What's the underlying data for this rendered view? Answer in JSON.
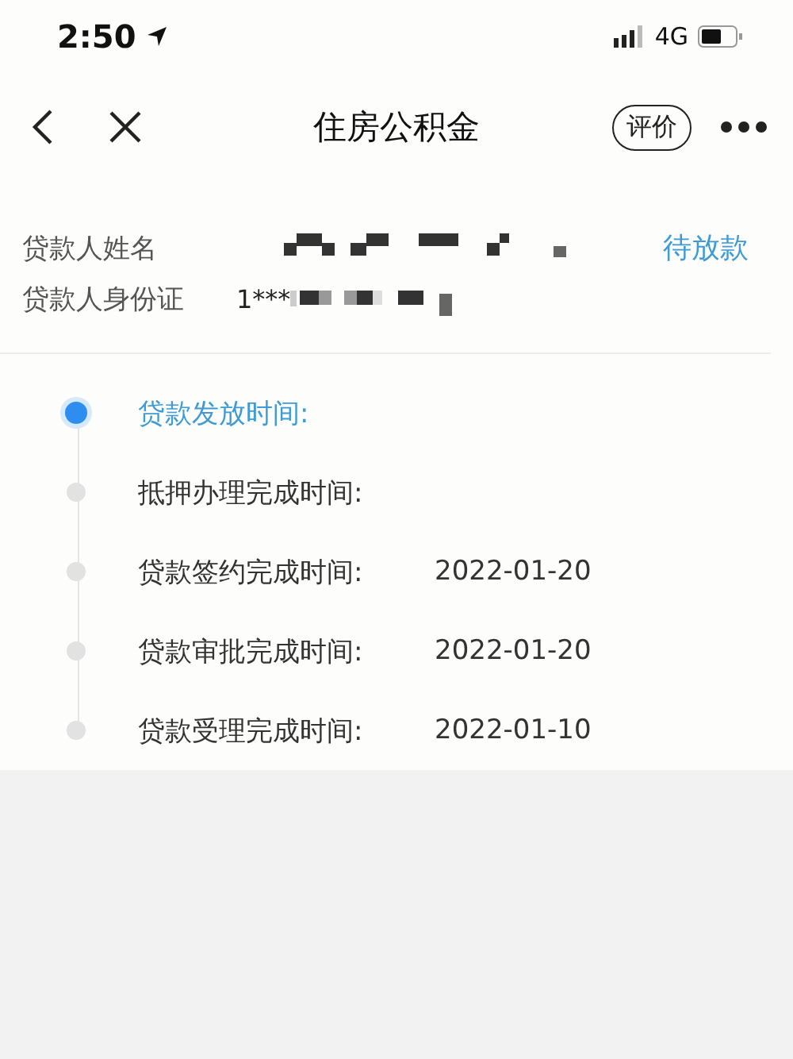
{
  "status_bar": {
    "time": "2:50",
    "network": "4G"
  },
  "nav": {
    "title": "住房公积金",
    "rate_button": "评价"
  },
  "info": {
    "rows": [
      {
        "label": "贷款人姓名",
        "value": ""
      },
      {
        "label": "贷款人身份证",
        "value": "1***"
      }
    ],
    "status": "待放款"
  },
  "steps": [
    {
      "label": "贷款发放时间:",
      "selected": true
    },
    {
      "label": "抵押办理完成时间:",
      "selected": false
    },
    {
      "label": "贷款签约完成时间:",
      "date": "2022-01-20",
      "selected": false
    },
    {
      "label": "贷款审批完成时间:",
      "date": "2022-01-20",
      "selected": false
    },
    {
      "label": "贷款受理完成时间:",
      "date": "2022-01-10",
      "selected": false
    }
  ]
}
